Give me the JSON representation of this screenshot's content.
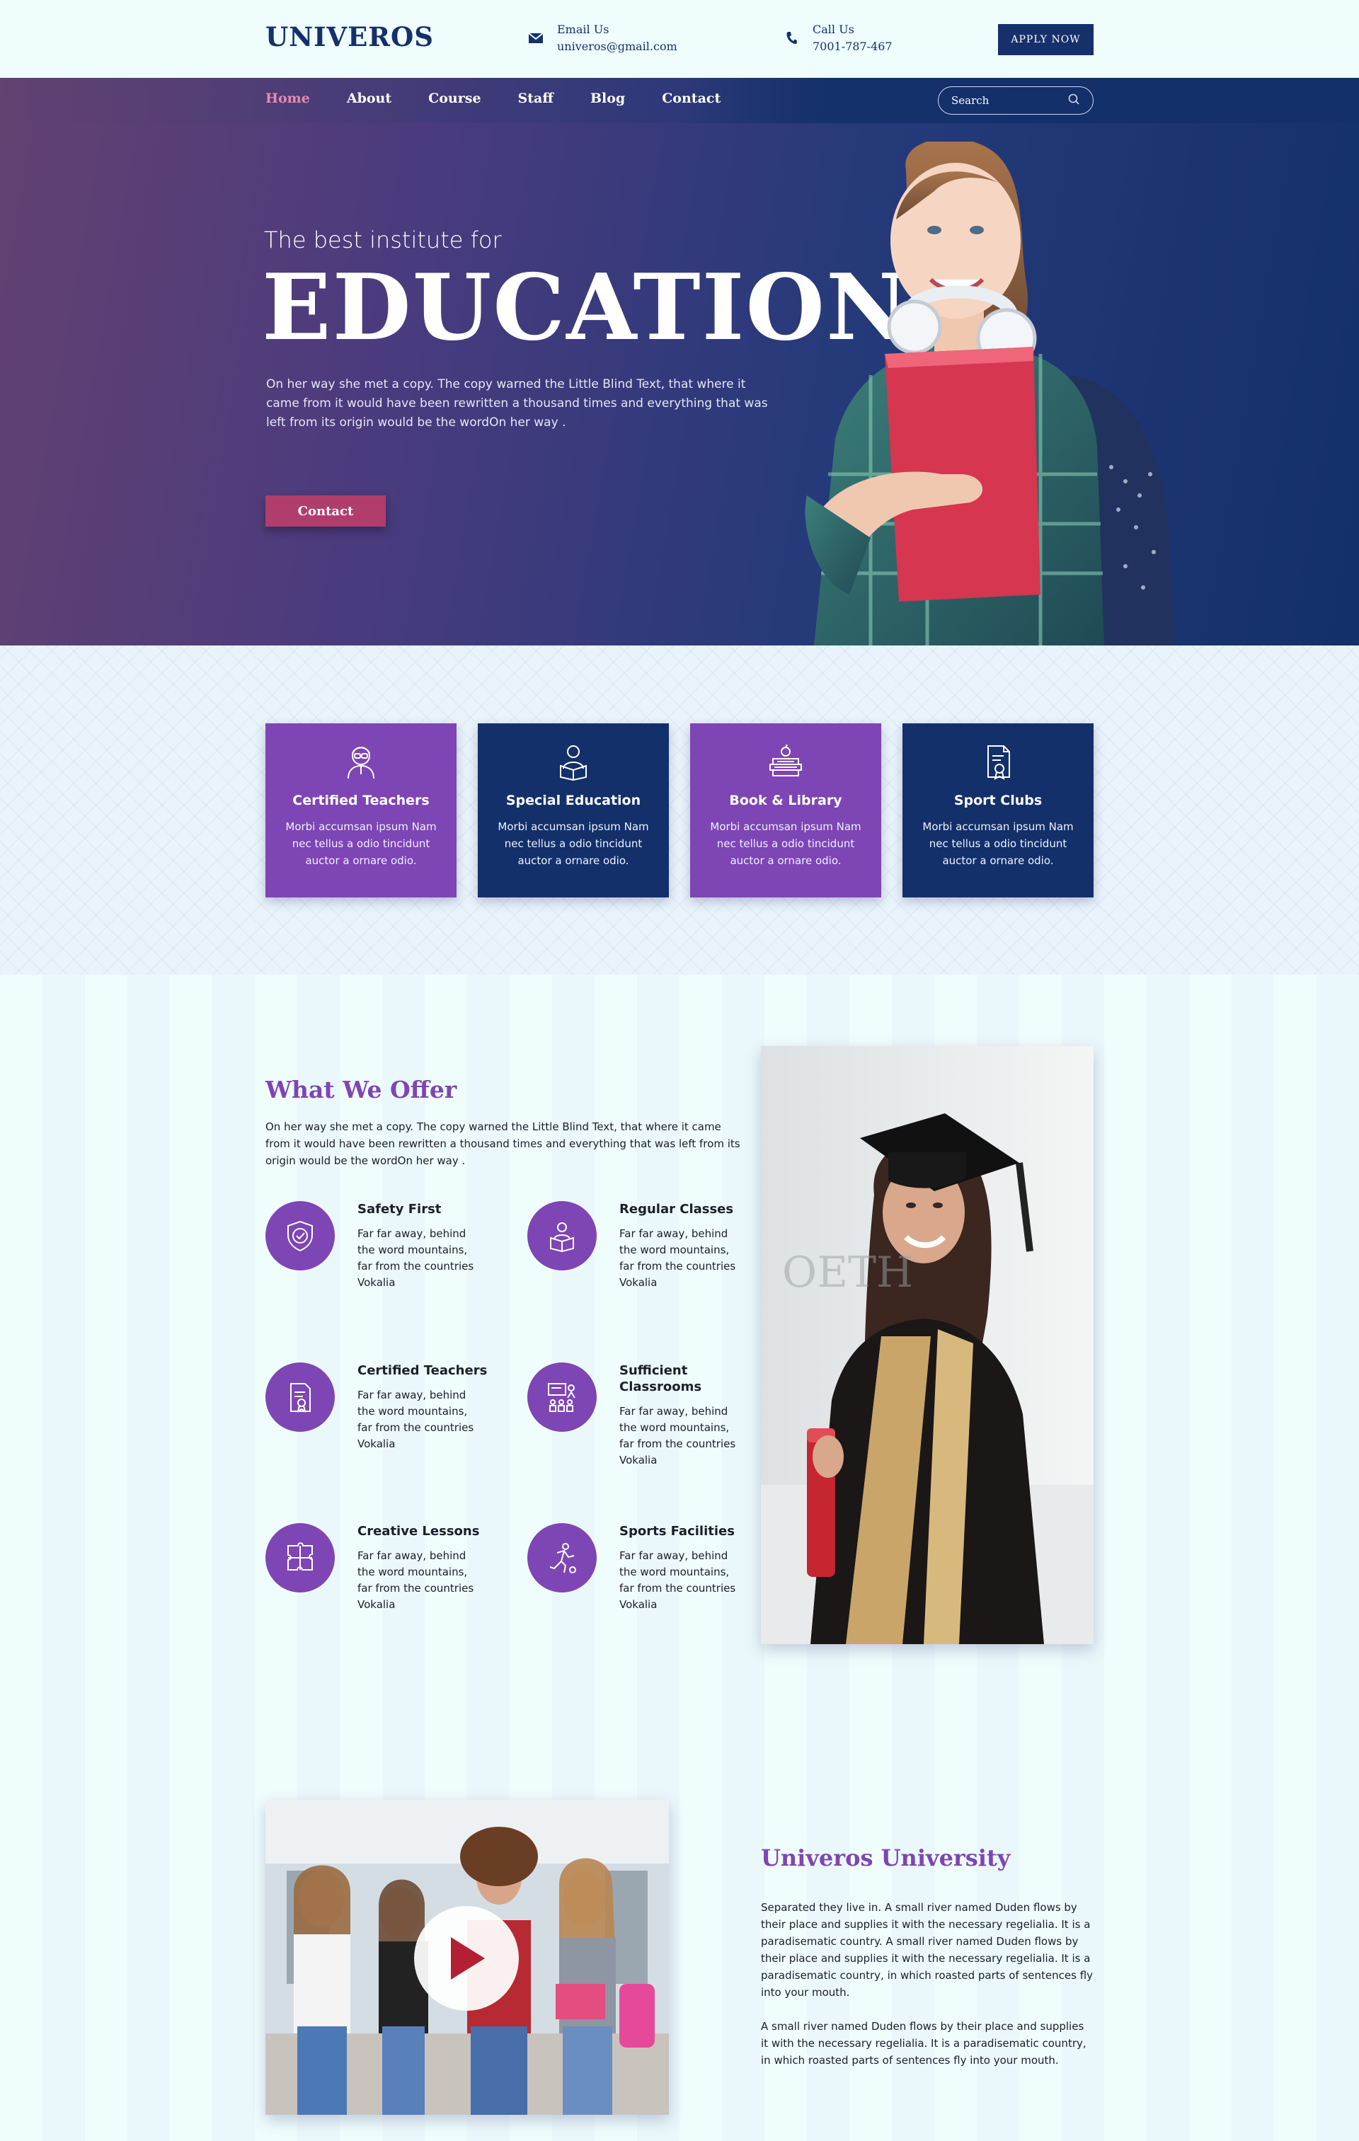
{
  "header": {
    "logo": "UNIVEROS",
    "email": {
      "label": "Email Us",
      "value": "univeros@gmail.com"
    },
    "phone": {
      "label": "Call Us",
      "value": "7001-787-467"
    },
    "apply_label": "APPLY NOW"
  },
  "nav": {
    "items": [
      {
        "label": "Home",
        "active": true
      },
      {
        "label": "About"
      },
      {
        "label": "Course"
      },
      {
        "label": "Staff"
      },
      {
        "label": "Blog"
      },
      {
        "label": "Contact"
      }
    ],
    "search_placeholder": "Search"
  },
  "hero": {
    "subtitle": "The best institute for",
    "title": "EDUCATION",
    "description": "On her way she met a copy. The copy warned the Little Blind Text, that where it came from it would have been rewritten a thousand times and everything that was left from its origin would be the wordOn her way .",
    "button_label": "Contact"
  },
  "features": [
    {
      "title": "Certified Teachers",
      "text": "Morbi accumsan ipsum Nam nec tellus a odio tincidunt auctor a ornare odio.",
      "icon": "teacher-icon",
      "color": "#7e45b4"
    },
    {
      "title": "Special Education",
      "text": "Morbi accumsan ipsum Nam nec tellus a odio tincidunt auctor a ornare odio.",
      "icon": "reader-icon",
      "color": "#13306a"
    },
    {
      "title": "Book & Library",
      "text": "Morbi accumsan ipsum Nam nec tellus a odio tincidunt auctor a ornare odio.",
      "icon": "books-icon",
      "color": "#7e45b4"
    },
    {
      "title": "Sport Clubs",
      "text": "Morbi accumsan ipsum Nam nec tellus a odio tincidunt auctor a ornare odio.",
      "icon": "certificate-icon",
      "color": "#13306a"
    }
  ],
  "offer": {
    "title": "What We Offer",
    "description": "On her way she met a copy. The copy warned the Little Blind Text, that where it came from it would have been rewritten a thousand times and everything that was left from its origin would be the wordOn her way .",
    "items": [
      {
        "title": "Safety First",
        "text": "Far far away, behind the word mountains, far from the countries Vokalia",
        "icon": "shield-icon"
      },
      {
        "title": "Regular Classes",
        "text": "Far far away, behind the word mountains, far from the countries Vokalia",
        "icon": "reading-icon"
      },
      {
        "title": "Certified Teachers",
        "text": "Far far away, behind the word mountains, far from the countries Vokalia",
        "icon": "certificate-icon"
      },
      {
        "title": "Sufficient Classrooms",
        "text": "Far far away, behind the word mountains, far from the countries Vokalia",
        "icon": "classroom-icon"
      },
      {
        "title": "Creative Lessons",
        "text": "Far far away, behind the word mountains, far from the countries Vokalia",
        "icon": "puzzle-icon"
      },
      {
        "title": "Sports Facilities",
        "text": "Far far away, behind the word mountains, far from the countries Vokalia",
        "icon": "sports-icon"
      }
    ]
  },
  "university": {
    "title": "Univeros University",
    "paragraph_1": "Separated they live in. A small river named Duden flows by their place and supplies it with the necessary regelialia. It is a paradisematic country. A small river named Duden flows by their place and supplies it with the necessary regelialia. It is a paradisematic country, in which roasted parts of sentences fly into your mouth.",
    "paragraph_2": "A small river named Duden flows by their place and supplies it with the necessary regelialia. It is a paradisematic country, in which roasted parts of sentences fly into your mouth."
  },
  "colors": {
    "brand_navy": "#15306a",
    "accent_purple": "#7e45b4",
    "accent_pink": "#b13d6d",
    "nav_active": "#e58ab3",
    "page_bg": "#effdfd"
  }
}
